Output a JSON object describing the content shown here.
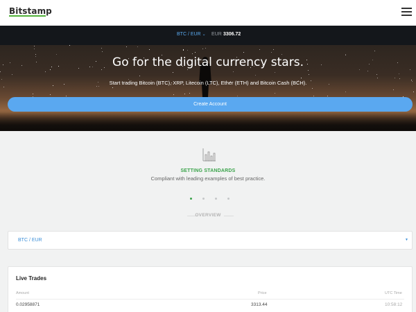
{
  "header": {
    "logo": "Bitstamp",
    "menu_icon": "hamburger-menu-icon"
  },
  "ticker": {
    "pair": "BTC / EUR",
    "currency": "EUR",
    "price": "3306.72"
  },
  "hero": {
    "title": "Go for the digital currency stars.",
    "subtitle": "Start trading Bitcoin (BTC), XRP, Litecoin (LTC), Ether (ETH) and Bitcoin Cash (BCH).",
    "cta_label": "Create Account"
  },
  "feature": {
    "icon": "bar-chart-icon",
    "title": "SETTING STANDARDS",
    "description": "Compliant with leading examples of best practice.",
    "slide_count": 4,
    "active_slide": 1
  },
  "overview": {
    "label": "OVERVIEW"
  },
  "pair_dropdown": {
    "value": "BTC / EUR"
  },
  "live_trades": {
    "title": "Live Trades",
    "columns": [
      "Amount",
      "Price",
      "UTC Time"
    ],
    "rows": [
      {
        "amount": "0.02958871",
        "price": "3313.44",
        "time": "10:58:12"
      }
    ]
  },
  "colors": {
    "accent_green": "#3aa34a",
    "accent_blue": "#5aa8f0",
    "ticker_bg": "#14171b"
  }
}
